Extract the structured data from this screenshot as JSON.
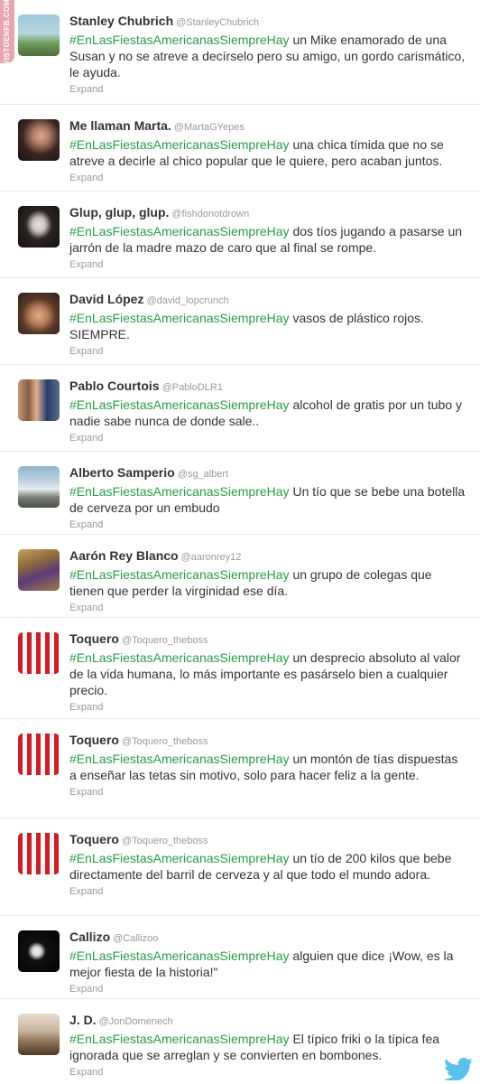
{
  "watermark": "VISTOENFB.COM",
  "colors": {
    "hashtag": "#2a9a4a",
    "name": "#333333",
    "muted": "#999999",
    "watermark": "#e8a6b0",
    "bird": "#5bc0eb"
  },
  "tweets": [
    {
      "name": "Stanley Chubrich",
      "handle": "@StanleyChubrich",
      "hashtag": "#EnLasFiestasAmericanasSiempreHay",
      "text": " un Mike enamorado de una Susan y no se atreve a decírselo pero su amigo, un gordo carismático, le ayuda.",
      "expand": "Expand",
      "avatar": "landscape"
    },
    {
      "name": "Me llaman Marta.",
      "handle": "@MartaGYepes",
      "hashtag": "#EnLasFiestasAmericanasSiempreHay",
      "text": " una chica tímida que no se atreve a decirle al chico popular que le quiere, pero acaban juntos.",
      "expand": "Expand",
      "avatar": "portrait-dark"
    },
    {
      "name": "Glup, glup, glup.",
      "handle": "@fishdonotdrown",
      "hashtag": "#EnLasFiestasAmericanasSiempreHay",
      "text": " dos tíos jugando a pasarse un jarrón de la madre mazo de caro que al final se rompe.",
      "expand": "Expand",
      "avatar": "portrait-bw"
    },
    {
      "name": "David López",
      "handle": "@david_lopcrunch",
      "hashtag": "#EnLasFiestasAmericanasSiempreHay",
      "text": " vasos de plástico rojos. SIEMPRE.",
      "expand": "Expand",
      "avatar": "portrait-warm"
    },
    {
      "name": "Pablo Courtois",
      "handle": "@PabloDLR1",
      "hashtag": "#EnLasFiestasAmericanasSiempreHay",
      "text": " alcohol de gratis por un tubo y nadie sabe nunca de donde sale..",
      "expand": "Expand",
      "avatar": "group"
    },
    {
      "name": "Alberto Samperio",
      "handle": "@sg_albert",
      "hashtag": "#EnLasFiestasAmericanasSiempreHay",
      "text": " Un tío que se bebe una botella de cerveza por un embudo",
      "expand": "Expand",
      "avatar": "airplane"
    },
    {
      "name": "Aarón Rey Blanco",
      "handle": "@aaronrey12",
      "hashtag": "#EnLasFiestasAmericanasSiempreHay",
      "text": " un grupo de colegas que tienen que perder la virginidad ese día.",
      "expand": "Expand",
      "avatar": "sports"
    },
    {
      "name": "Toquero",
      "handle": "@Toquero_theboss",
      "hashtag": "#EnLasFiestasAmericanasSiempreHay",
      "text": " un desprecio absoluto al valor de la vida humana, lo más importante es pasárselo bien a cualquier precio.",
      "expand": "Expand",
      "avatar": "player"
    },
    {
      "name": "Toquero",
      "handle": "@Toquero_theboss",
      "hashtag": "#EnLasFiestasAmericanasSiempreHay",
      "text": " un montón de tías dispuestas a enseñar las tetas sin motivo, solo para hacer feliz a la gente.",
      "expand": "Expand",
      "avatar": "player"
    },
    {
      "name": "Toquero",
      "handle": "@Toquero_theboss",
      "hashtag": "#EnLasFiestasAmericanasSiempreHay",
      "text": " un tío de 200 kilos que bebe directamente del barril de cerveza y al que todo el mundo adora.",
      "expand": "Expand",
      "avatar": "player"
    },
    {
      "name": "Callizo",
      "handle": "@Callizoo",
      "hashtag": "#EnLasFiestasAmericanasSiempreHay",
      "text": " alguien que dice ¡Wow, es la mejor fiesta de la historia!\"",
      "expand": "Expand",
      "avatar": "dark-face"
    },
    {
      "name": "J. D.",
      "handle": "@JonDomenech",
      "hashtag": "#EnLasFiestasAmericanasSiempreHay",
      "text": " El típico friki o la típica fea ignorada que se arreglan y se convierten en bombones.",
      "expand": "Expand",
      "avatar": "standing"
    }
  ]
}
